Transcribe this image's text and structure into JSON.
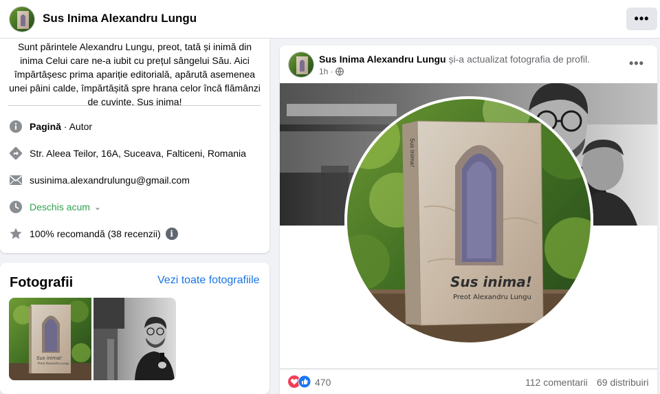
{
  "header": {
    "page_name": "Sus Inima Alexandru Lungu",
    "more_label": "•••"
  },
  "intro": {
    "bio": "Sunt părintele Alexandru Lungu, preot, tată și inimă din inima Celui care ne-a iubit cu prețul sângelui Său. Aici împărtășesc prima apariție editorială, apărută asemenea unei pâini calde, împărtășită spre hrana celor încă flămânzi de cuvinte. Sus inima!",
    "category_label": "Pagină",
    "category_value": "· Autor",
    "address": "Str. Aleea Teilor, 16A, Suceava, Falticeni, Romania",
    "email": "susinima.alexandrulungu@gmail.com",
    "hours": "Deschis acum",
    "rating": "100% recomandă (38 recenzii)"
  },
  "photos": {
    "title": "Fotografii",
    "see_all": "Vezi toate fotografiile"
  },
  "post": {
    "author": "Sus Inima Alexandru Lungu",
    "action": " și-a actualizat fotografia de profil.",
    "time": "1h ·",
    "more_label": "•••",
    "book_title": "Sus inima!",
    "book_author": "Preot Alexandru Lungu",
    "reactions_count": "470",
    "comments": "112 comentarii",
    "shares": "69 distribuiri"
  },
  "colors": {
    "link": "#1b74e4",
    "open_green": "#31a24c",
    "secondary_text": "#65676b",
    "like_blue": "#1877f2",
    "love_red": "#f33e58"
  },
  "icons": [
    "info-icon",
    "directions-icon",
    "mail-icon",
    "clock-icon",
    "star-icon",
    "globe-icon",
    "like-icon",
    "love-icon",
    "more-icon",
    "chevron-down-icon"
  ]
}
